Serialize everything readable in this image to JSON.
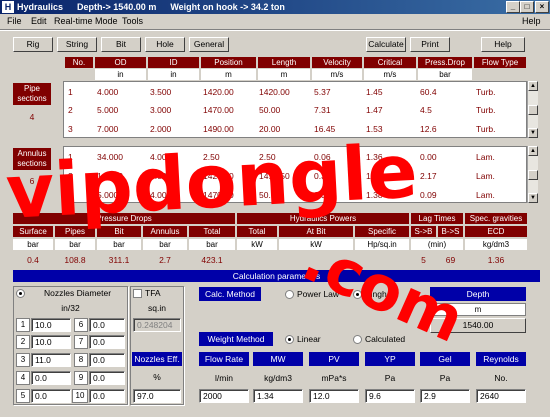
{
  "window": {
    "app_icon": "H",
    "app_name": "Hydraulics",
    "depth": "Depth-> 1540.00 m",
    "wob": "Weight on hook -> 34.2 ton",
    "controls": [
      "_",
      "□",
      "×"
    ]
  },
  "menu": [
    "File",
    "Edit",
    "Real-time Mode",
    "Tools",
    "Help"
  ],
  "toolbar": {
    "left": [
      "Rig",
      "String",
      "Bit",
      "Hole",
      "General"
    ],
    "right": [
      "Calculate",
      "Print",
      "Help"
    ]
  },
  "pipe_table": {
    "headers": [
      "No.",
      "OD",
      "ID",
      "Position",
      "Length",
      "Velocity",
      "Critical",
      "Press.Drop",
      "Flow Type"
    ],
    "units": [
      "",
      "in",
      "in",
      "m",
      "m",
      "m/s",
      "m/s",
      "bar",
      ""
    ],
    "pipe_label": "Pipe sections",
    "pipe_count": "4",
    "pipe_rows": [
      [
        "1",
        "4.000",
        "3.500",
        "1420.00",
        "1420.00",
        "5.37",
        "1.45",
        "60.4",
        "Turb."
      ],
      [
        "2",
        "5.000",
        "3.000",
        "1470.00",
        "50.00",
        "7.31",
        "1.47",
        "4.5",
        "Turb."
      ],
      [
        "3",
        "7.000",
        "2.000",
        "1490.00",
        "20.00",
        "16.45",
        "1.53",
        "12.6",
        "Turb."
      ]
    ],
    "annulus_label": "Annulus sections",
    "annulus_count": "6",
    "annulus_rows": [
      [
        "1",
        "34.000",
        "4.000",
        "2.50",
        "2.50",
        "0.06",
        "1.36",
        "0.00",
        "Lam."
      ],
      [
        "2",
        "14.000",
        "4.000",
        "1420.00",
        "1417.50",
        "0.37",
        "1.38",
        "2.17",
        "Lam."
      ],
      [
        "3",
        "5.000",
        "4.000",
        "1470.00",
        "50.00",
        "0.38",
        "1.38",
        "0.09",
        "Lam."
      ]
    ]
  },
  "results": {
    "group1": "Pressure Drops",
    "group2": "Hydraulics Powers",
    "group3": "Lag Times",
    "group4": "Spec. gravities",
    "headers": [
      "Surface",
      "Pipes",
      "Bit",
      "Annulus",
      "Total",
      "Total",
      "At Bit",
      "Specific",
      "S->B",
      "B->S",
      "ECD"
    ],
    "units": [
      "bar",
      "bar",
      "bar",
      "bar",
      "bar",
      "kW",
      "kW",
      "Hp/sq.in",
      "(min)",
      "",
      "kg/dm3"
    ],
    "values": [
      "0.4",
      "108.8",
      "311.1",
      "2.7",
      "423.1",
      "",
      "",
      "",
      "5",
      "69",
      "1.36"
    ]
  },
  "calc": {
    "title": "Calculation parameters",
    "nozzles_label": "Nozzles Diameter",
    "nozzles_unit": "in/32",
    "tfa_label": "TFA",
    "tfa_unit": "sq.in",
    "tfa_value": "0.248204",
    "nozzles": [
      {
        "n": "1",
        "v": "10.0"
      },
      {
        "n": "2",
        "v": "10.0"
      },
      {
        "n": "3",
        "v": "11.0"
      },
      {
        "n": "4",
        "v": "0.0"
      },
      {
        "n": "5",
        "v": "0.0"
      },
      {
        "n": "6",
        "v": "0.0"
      },
      {
        "n": "7",
        "v": "0.0"
      },
      {
        "n": "8",
        "v": "0.0"
      },
      {
        "n": "9",
        "v": "0.0"
      },
      {
        "n": "10",
        "v": "0.0"
      }
    ],
    "eff_label": "Nozzles Eff.",
    "eff_unit": "%",
    "eff_value": "97.0",
    "calc_method_label": "Calc. Method",
    "power_law": "Power Law",
    "bingham": "Bingham",
    "depth_label": "Depth",
    "depth_unit": "m",
    "depth_value": "1540.00",
    "weight_method_label": "Weight Method",
    "linear": "Linear",
    "calculated": "Calculated",
    "params": [
      {
        "label": "Flow Rate",
        "unit": "l/min",
        "value": "2000"
      },
      {
        "label": "MW",
        "unit": "kg/dm3",
        "value": "1.34"
      },
      {
        "label": "PV",
        "unit": "mPa*s",
        "value": "12.0"
      },
      {
        "label": "YP",
        "unit": "Pa",
        "value": "9.6"
      },
      {
        "label": "Gel",
        "unit": "Pa",
        "value": "2.9"
      },
      {
        "label": "Reynolds",
        "unit": "No.",
        "value": "2640"
      }
    ]
  },
  "watermark": {
    "text1": "vipdongle",
    "text2": ".com",
    "color": "#ff0000"
  }
}
